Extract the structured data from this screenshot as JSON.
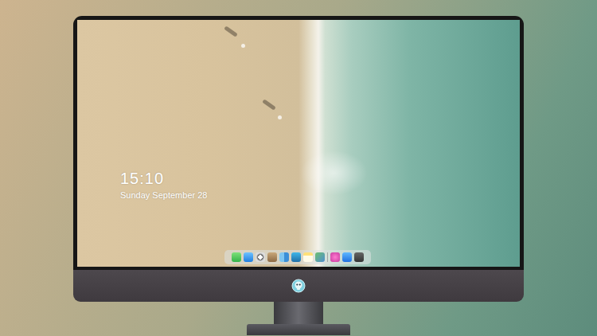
{
  "lock_screen": {
    "time": "15:10",
    "date": "Sunday September 28"
  }
}
